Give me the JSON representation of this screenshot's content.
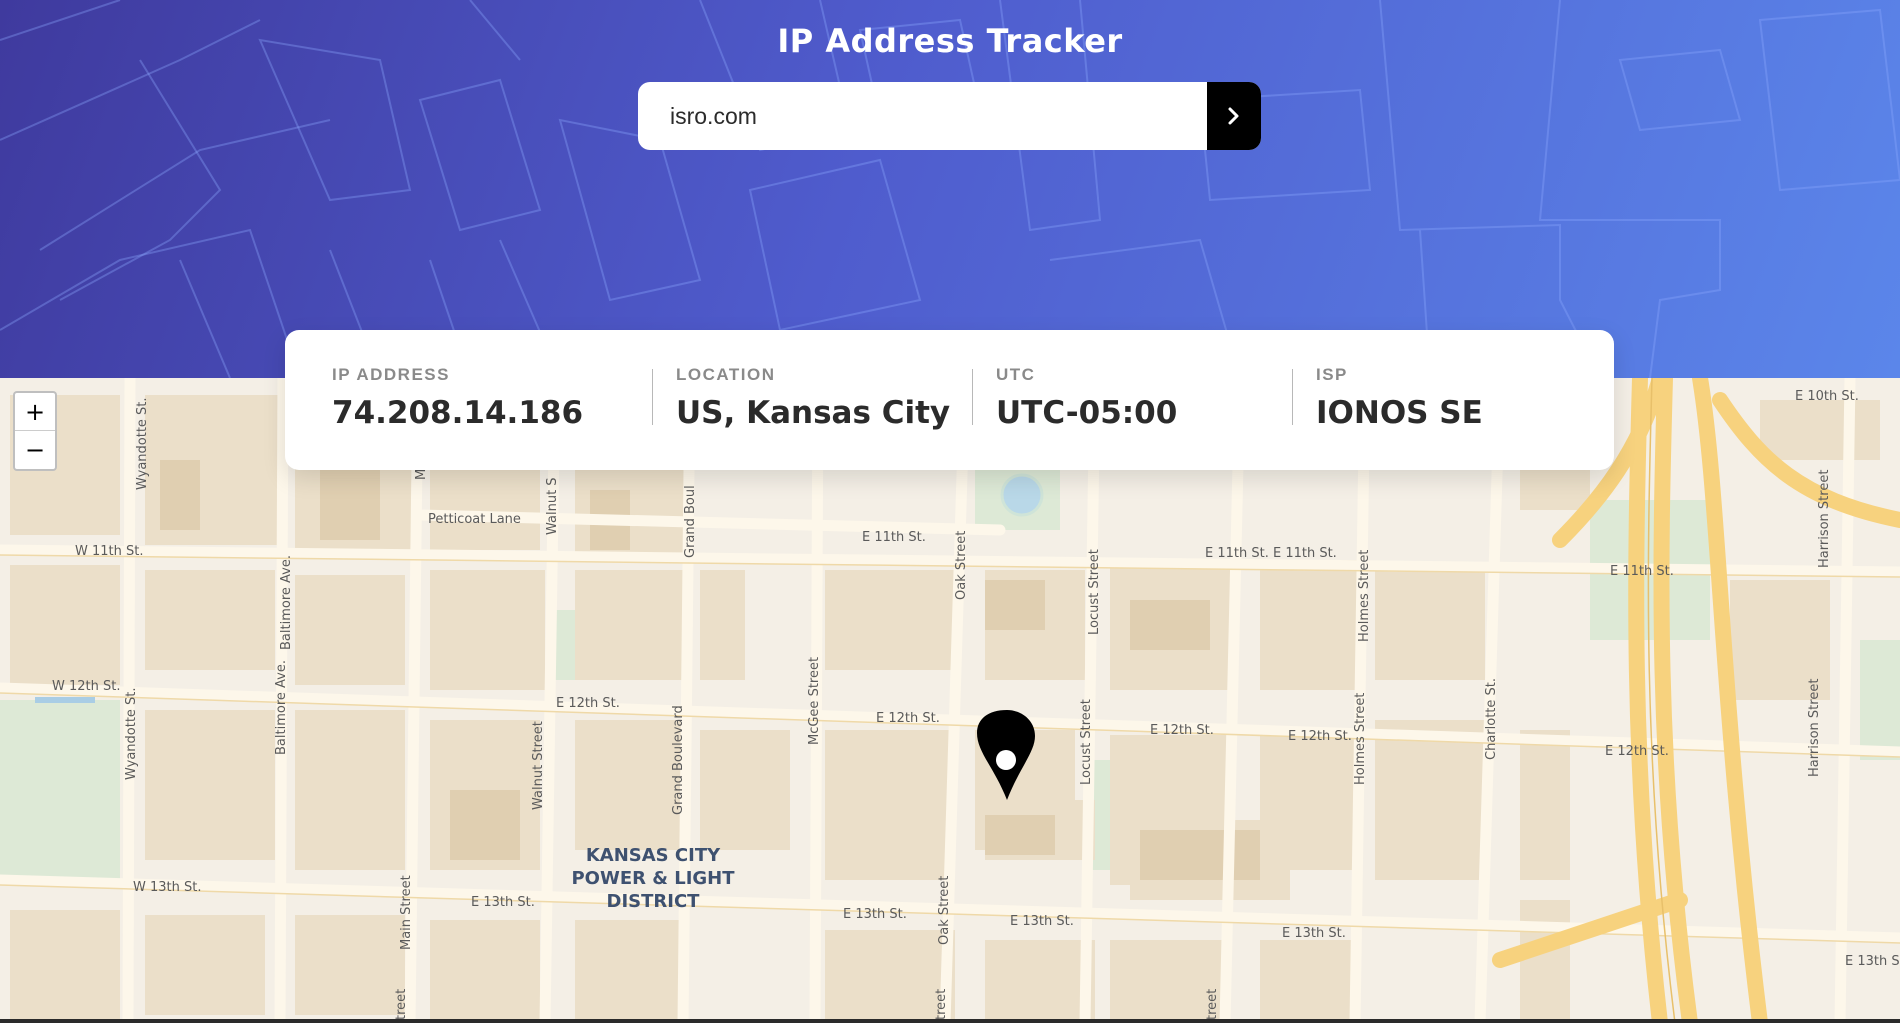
{
  "header": {
    "title": "IP Address Tracker"
  },
  "search": {
    "value": "isro.com",
    "button_icon": "chevron-right-icon"
  },
  "info": [
    {
      "label": "IP ADDRESS",
      "value": "74.208.14.186"
    },
    {
      "label": "LOCATION",
      "value": "US, Kansas City"
    },
    {
      "label": "UTC",
      "value": "UTC-05:00"
    },
    {
      "label": "ISP",
      "value": "IONOS SE"
    }
  ],
  "map": {
    "zoom_in": "+",
    "zoom_out": "−",
    "district_lines": [
      "KANSAS CITY",
      "POWER & LIGHT",
      "DISTRICT"
    ],
    "streets": {
      "e10th": "E 10th St.",
      "w11th": "W 11th St.",
      "e11th_a": "E 11th St.",
      "e11th_b": "E 11th St. E 11th St.",
      "e11th_c": "E 11th St.",
      "petticoat": "Petticoat Lane",
      "w12th": "W 12th St.",
      "e12th_a": "E 12th St.",
      "e12th_b": "E 12th St.",
      "e12th_c": "E 12th St.",
      "e12th_d": "E 12th St.",
      "e12th_e": "E 12th St.",
      "w13th": "W 13th St.",
      "e13th_a": "E 13th St.",
      "e13th_b": "E 13th St.",
      "e13th_c": "E 13th St.",
      "e13th_d": "E 13th St.",
      "e13th_e": "E 13th S",
      "wyandotte_a": "Wyandotte St.",
      "wyandotte_b": "Wyandotte St.",
      "baltimore_a": "Baltimore Ave.",
      "baltimore_b": "Baltimore Ave.",
      "main_a": "M",
      "main_b": "Main Street",
      "main_c": "treet",
      "walnut_a": "Walnut S",
      "walnut_b": "Walnut Street",
      "grand_a": "Grand Boul",
      "grand_b": "Grand Boulevard",
      "mcgee": "McGee Street",
      "oak_a": "Oak Street",
      "oak_b": "Oak Street",
      "oak_c": "treet",
      "locust_a": "Locust Street",
      "locust_b": "Locust Street",
      "locust_c": "treet",
      "holmes_a": "Holmes Street",
      "holmes_b": "Holmes Street",
      "charlotte": "Charlotte St.",
      "harrison_a": "Harrison Street",
      "harrison_b": "Harrison Street"
    }
  },
  "colors": {
    "header_start": "#3f3a9e",
    "header_end": "#5b86ea",
    "map_land": "#f4efe6",
    "map_block": "#ebdfc9",
    "map_street": "#fdf7ea",
    "map_highway": "#f7d27e",
    "map_park": "#dde9d6",
    "marker": "#000000"
  }
}
